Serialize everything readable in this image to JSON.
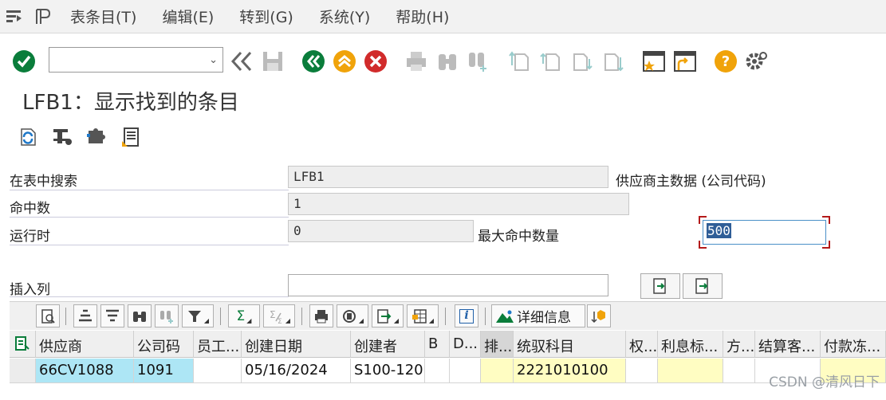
{
  "menu": {
    "items": [
      "表条目(T)",
      "编辑(E)",
      "转到(G)",
      "系统(Y)",
      "帮助(H)"
    ]
  },
  "toolbar": {
    "command_field_value": "",
    "icons": [
      "check-icon",
      "save-icon",
      "back-icon",
      "exit-icon",
      "cancel-icon",
      "print-icon",
      "find-icon",
      "find-next-icon",
      "first-page-icon",
      "prev-page-icon",
      "next-page-icon",
      "last-page-icon",
      "new-session-icon",
      "shortcut-icon",
      "help-icon",
      "settings-icon"
    ],
    "colors": {
      "check": "#0a7d3b",
      "back": "#0a7d3b",
      "exit": "#f0a30a",
      "cancel": "#d12b2b",
      "help": "#f0a30a"
    }
  },
  "page": {
    "title": "LFB1：显示找到的条目"
  },
  "form": {
    "search_label": "在表中搜索",
    "search_value": "LFB1",
    "search_desc": "供应商主数据 (公司代码)",
    "hits_label": "命中数",
    "hits_value": "1",
    "runtime_label": "运行时",
    "runtime_value": "0",
    "max_hits_label": "最大命中数量",
    "max_hits_value": "500",
    "insert_col_label": "插入列",
    "insert_col_value": ""
  },
  "alv": {
    "detail_label": "详细信息",
    "sum_symbol": "Σ",
    "info_symbol": "i"
  },
  "grid": {
    "columns": [
      "供应商",
      "公司码",
      "员工...",
      "创建日期",
      "创建者",
      "B",
      "D...",
      "排...",
      "统驭科目",
      "权...",
      "利息标...",
      "方...",
      "结算客...",
      "付款冻..."
    ],
    "rows": [
      [
        "66CV1088",
        "1091",
        "",
        "05/16/2024",
        "S100-120",
        "",
        "",
        "",
        "2221010100",
        "",
        "",
        "",
        "",
        ""
      ]
    ]
  },
  "watermark": "CSDN @清风日下"
}
